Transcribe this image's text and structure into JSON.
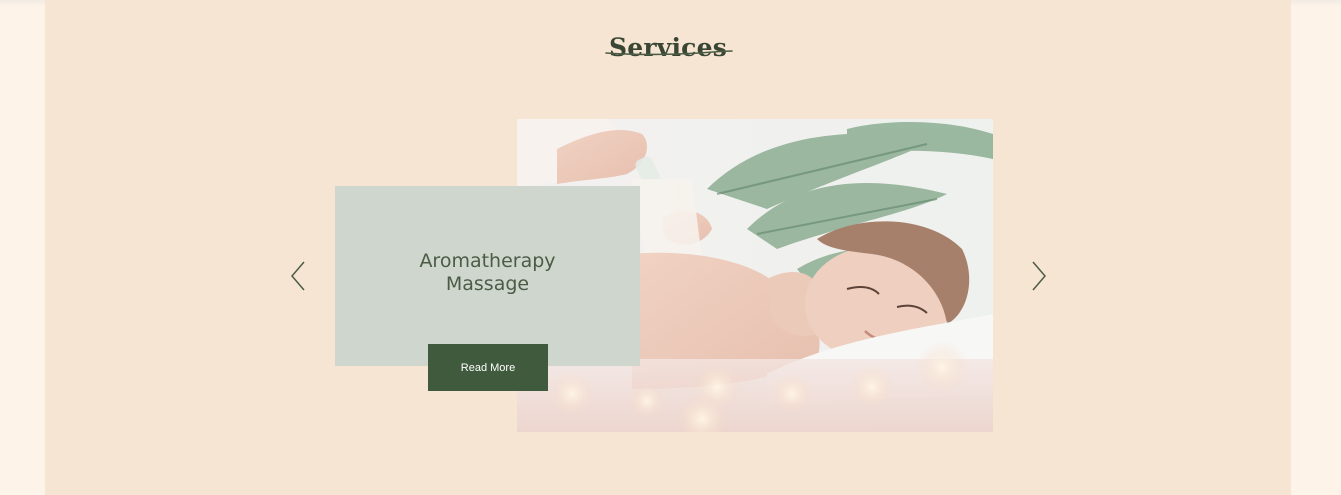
{
  "services": {
    "title": "Services"
  },
  "slider": {
    "prev_icon": "chevron-left-icon",
    "next_icon": "chevron-right-icon",
    "current_slide": {
      "title": "Aromatherapy\nMassage",
      "button_label": "Read More",
      "image_alt": "woman receiving aromatherapy oil massage"
    }
  },
  "colors": {
    "page_background": "#fdf3e8",
    "section_background": "#f7e5d3",
    "card_background": "#cfd6ce",
    "button_background": "#3f5a3d",
    "title_color": "#3a4634",
    "arrow_color": "#4b5c45"
  }
}
